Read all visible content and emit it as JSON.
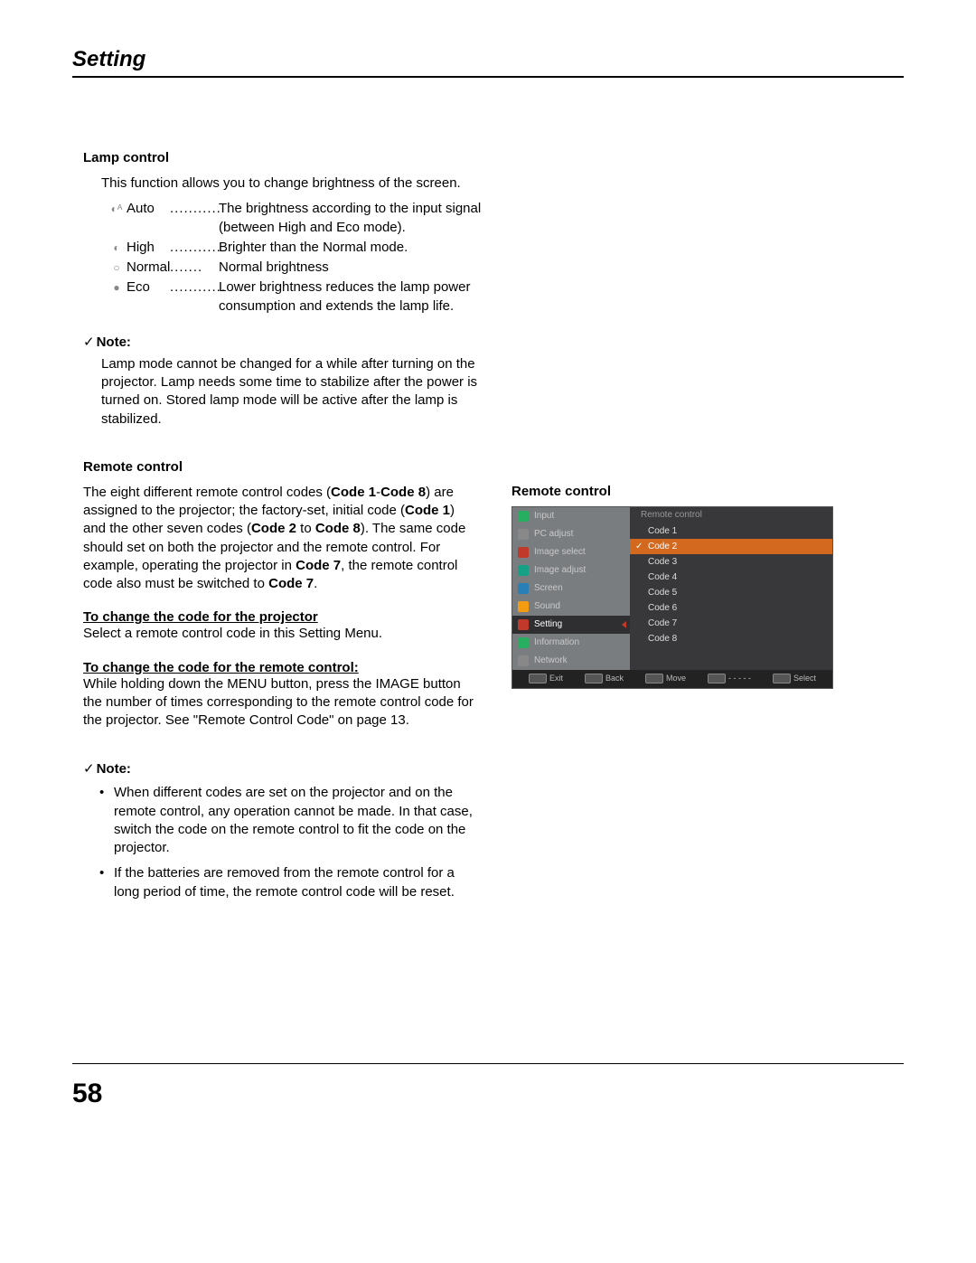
{
  "section_title": "Setting",
  "page_number": "58",
  "lamp": {
    "heading": "Lamp control",
    "intro": "This function allows you to change brightness of the screen.",
    "items": [
      {
        "glyph": "◐ᴬ",
        "name": "Auto",
        "dots": "...........",
        "desc": "The brightness according to the input signal (between High and Eco mode)."
      },
      {
        "glyph": "◐",
        "name": "High",
        "dots": "...........",
        "desc": "Brighter than the Normal mode."
      },
      {
        "glyph": "○",
        "name": "Normal",
        "dots": ".......",
        "desc": "Normal brightness"
      },
      {
        "glyph": "●",
        "name": "Eco",
        "dots": "............",
        "desc": "Lower brightness reduces the lamp power consumption and extends the lamp life."
      }
    ]
  },
  "note1": {
    "label": "Note:",
    "text": "Lamp mode cannot be changed for a while after turning on the projector. Lamp needs some time to stabilize after the power is turned on. Stored lamp mode will be active after the lamp is stabilized."
  },
  "remote": {
    "heading": "Remote control",
    "para_plain1": "The eight different remote control codes (",
    "para_bold1": "Code 1",
    "para_plain1b": "-",
    "para_bold1b": "Code 8",
    "para_plain1c": ") are assigned to the projector; the factory-set, initial code (",
    "para_bold2": "Code 1",
    "para_plain2": ") and the other seven codes (",
    "para_bold3": "Code 2",
    "para_plain3": " to ",
    "para_bold4": "Code 8",
    "para_plain4": "). The same code should set on both the projector and the remote control. For example, operating the projector in ",
    "para_bold5": "Code 7",
    "para_plain5": ", the remote control code also must be switched to ",
    "para_bold6": "Code 7",
    "para_plain6": ".",
    "sub1_head": "To change the code for the projector",
    "sub1_body": "Select a remote control code in this Setting Menu.",
    "sub2_head": "To change the code for the remote control:",
    "sub2_body": "While holding down the MENU button, press the IMAGE button the number of times corresponding to the remote control code for the projector. See \"Remote Control Code\" on page 13."
  },
  "note2": {
    "label": "Note:",
    "bullets": [
      "When different codes are set on the projector and on the remote control, any operation cannot be made. In that case, switch the code on the remote control to fit the code on the projector.",
      "If the batteries are removed from the remote control for a long period of time, the remote control code will be reset."
    ]
  },
  "figure": {
    "title": "Remote control",
    "sidebar": [
      {
        "label": "Input",
        "icon": "ic-input"
      },
      {
        "label": "PC adjust",
        "icon": "ic-pc"
      },
      {
        "label": "Image select",
        "icon": "ic-img"
      },
      {
        "label": "Image adjust",
        "icon": "ic-adj"
      },
      {
        "label": "Screen",
        "icon": "ic-screen"
      },
      {
        "label": "Sound",
        "icon": "ic-sound"
      },
      {
        "label": "Setting",
        "icon": "ic-setting",
        "active": true
      },
      {
        "label": "Information",
        "icon": "ic-info"
      },
      {
        "label": "Network",
        "icon": "ic-net"
      }
    ],
    "panel_head": "Remote control",
    "codes": [
      "Code 1",
      "Code 2",
      "Code 3",
      "Code 4",
      "Code 5",
      "Code 6",
      "Code 7",
      "Code 8"
    ],
    "selected_code": "Code 2",
    "footer": [
      "Exit",
      "Back",
      "Move",
      "- - - - -",
      "Select"
    ]
  }
}
